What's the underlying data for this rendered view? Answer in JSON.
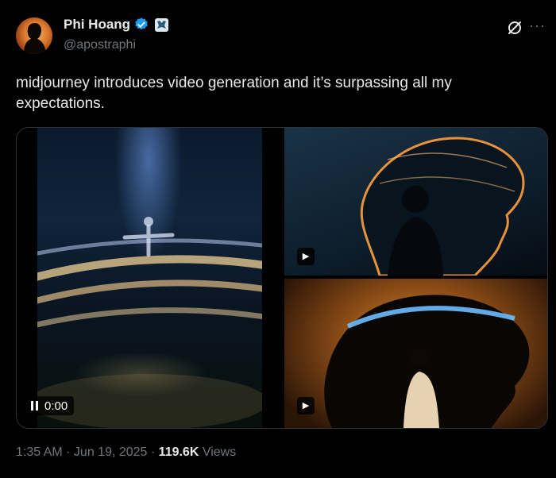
{
  "author": {
    "display_name": "Phi Hoang",
    "handle": "@apostraphi",
    "verified": true
  },
  "tweet": {
    "text": "midjourney introduces video generation and it’s surpassing all my expectations."
  },
  "media": {
    "main_video": {
      "timestamp": "0:00",
      "state": "playing"
    },
    "tiles": [
      "video",
      "video"
    ]
  },
  "meta": {
    "time": "1:35 AM",
    "separator1": " · ",
    "date": "Jun 19, 2025",
    "separator2": " · ",
    "views_count": "119.6K",
    "views_label": " Views"
  },
  "colors": {
    "background": "#000000",
    "verified_blue": "#1d9bf0",
    "muted": "#71767b"
  },
  "icons": {
    "verified": "verified-badge-icon",
    "affiliation": "affiliation-badge-icon",
    "grok": "grok-icon",
    "more": "more-icon",
    "play": "play-icon",
    "pause": "pause-icon"
  }
}
